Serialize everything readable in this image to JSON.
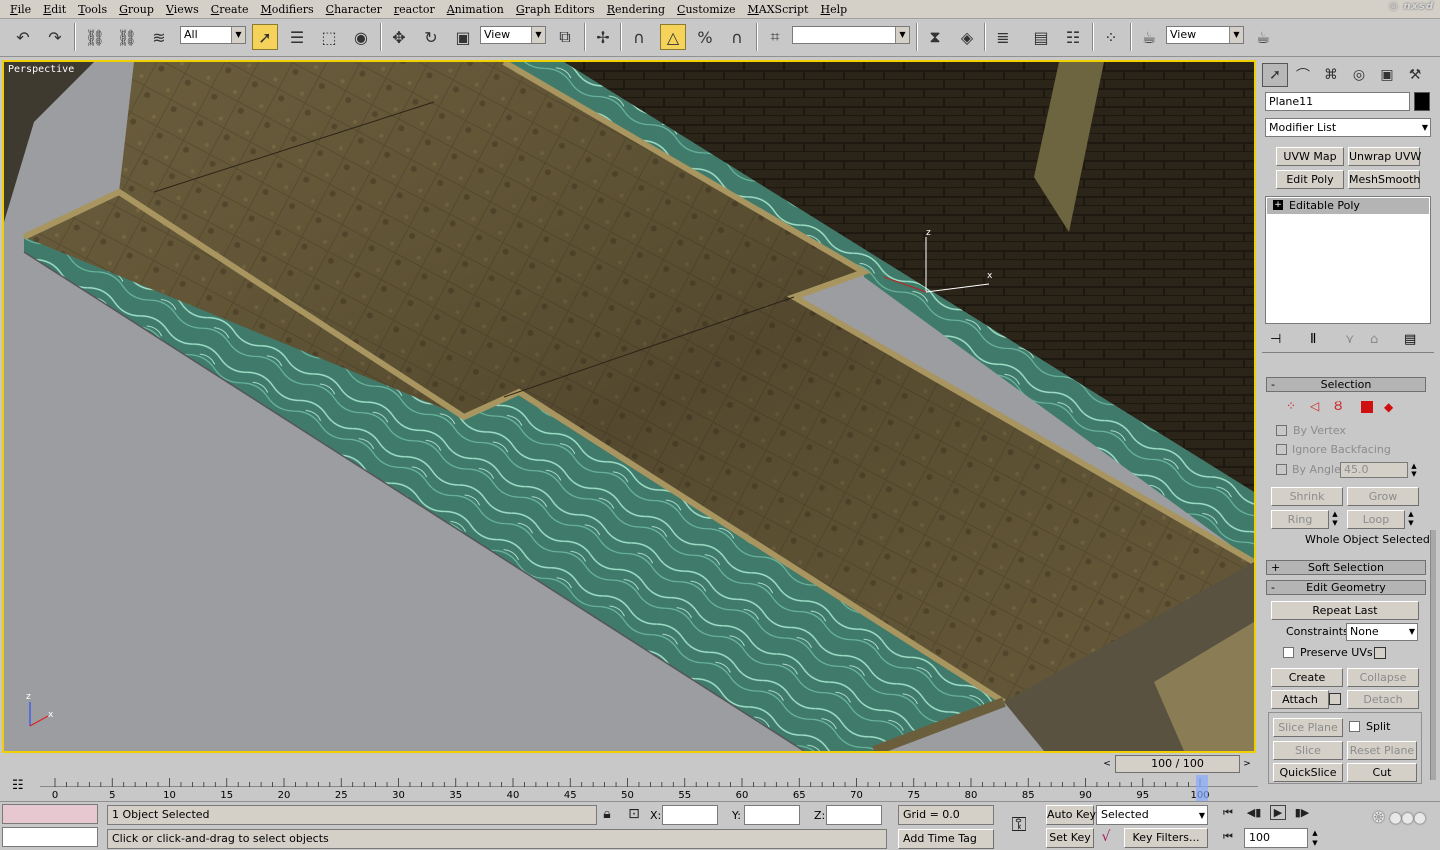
{
  "menu": [
    "File",
    "Edit",
    "Tools",
    "Group",
    "Views",
    "Create",
    "Modifiers",
    "Character",
    "reactor",
    "Animation",
    "Graph Editors",
    "Rendering",
    "Customize",
    "MAXScript",
    "Help"
  ],
  "toolbar": {
    "selection_filter": "All",
    "ref_coord": "View",
    "named_selection": "",
    "render_view": "View"
  },
  "viewport": {
    "label": "Perspective",
    "gizmo_x": "x",
    "gizmo_z": "z",
    "axis_x": "x",
    "axis_z": "z"
  },
  "panel": {
    "object_name": "Plane11",
    "object_color": "#000000",
    "modifier_list": "Modifier List",
    "modifier_buttons": [
      "UVW Map",
      "Unwrap UVW",
      "Edit Poly",
      "MeshSmooth"
    ],
    "stack_item": "Editable Poly",
    "stack_item_prefix": "+",
    "selection": {
      "title": "Selection",
      "by_vertex": "By Vertex",
      "ignore_backfacing": "Ignore Backfacing",
      "by_angle": "By Angle:",
      "angle_value": "45.0",
      "shrink": "Shrink",
      "grow": "Grow",
      "ring": "Ring",
      "loop": "Loop",
      "status": "Whole Object Selected"
    },
    "soft_selection": {
      "title": "Soft Selection",
      "prefix": "+"
    },
    "edit_geometry": {
      "title": "Edit Geometry",
      "prefix": "-",
      "repeat_last": "Repeat Last",
      "constraints_label": "Constraints:",
      "constraints_value": "None",
      "preserve_uvs": "Preserve UVs",
      "create": "Create",
      "collapse": "Collapse",
      "attach": "Attach",
      "detach": "Detach",
      "slice_plane": "Slice Plane",
      "split": "Split",
      "slice": "Slice",
      "reset_plane": "Reset Plane",
      "quickslice": "QuickSlice",
      "cut": "Cut"
    },
    "selection_prefix": "-"
  },
  "timeline": {
    "frame_display": "100 / 100",
    "ticks": [
      "0",
      "5",
      "10",
      "15",
      "20",
      "25",
      "30",
      "35",
      "40",
      "45",
      "50",
      "55",
      "60",
      "65",
      "70",
      "75",
      "80",
      "85",
      "90",
      "95",
      "100"
    ]
  },
  "status": {
    "selected_count": "1 Object Selected",
    "prompt": "Click or click-and-drag to select objects",
    "x_label": "X:",
    "y_label": "Y:",
    "z_label": "Z:",
    "grid": "Grid = 0.0",
    "add_time_tag": "Add Time Tag",
    "auto_key": "Auto Key",
    "set_key": "Set Key",
    "key_mode": "Selected",
    "key_filters": "Key Filters...",
    "current_frame": "100"
  }
}
